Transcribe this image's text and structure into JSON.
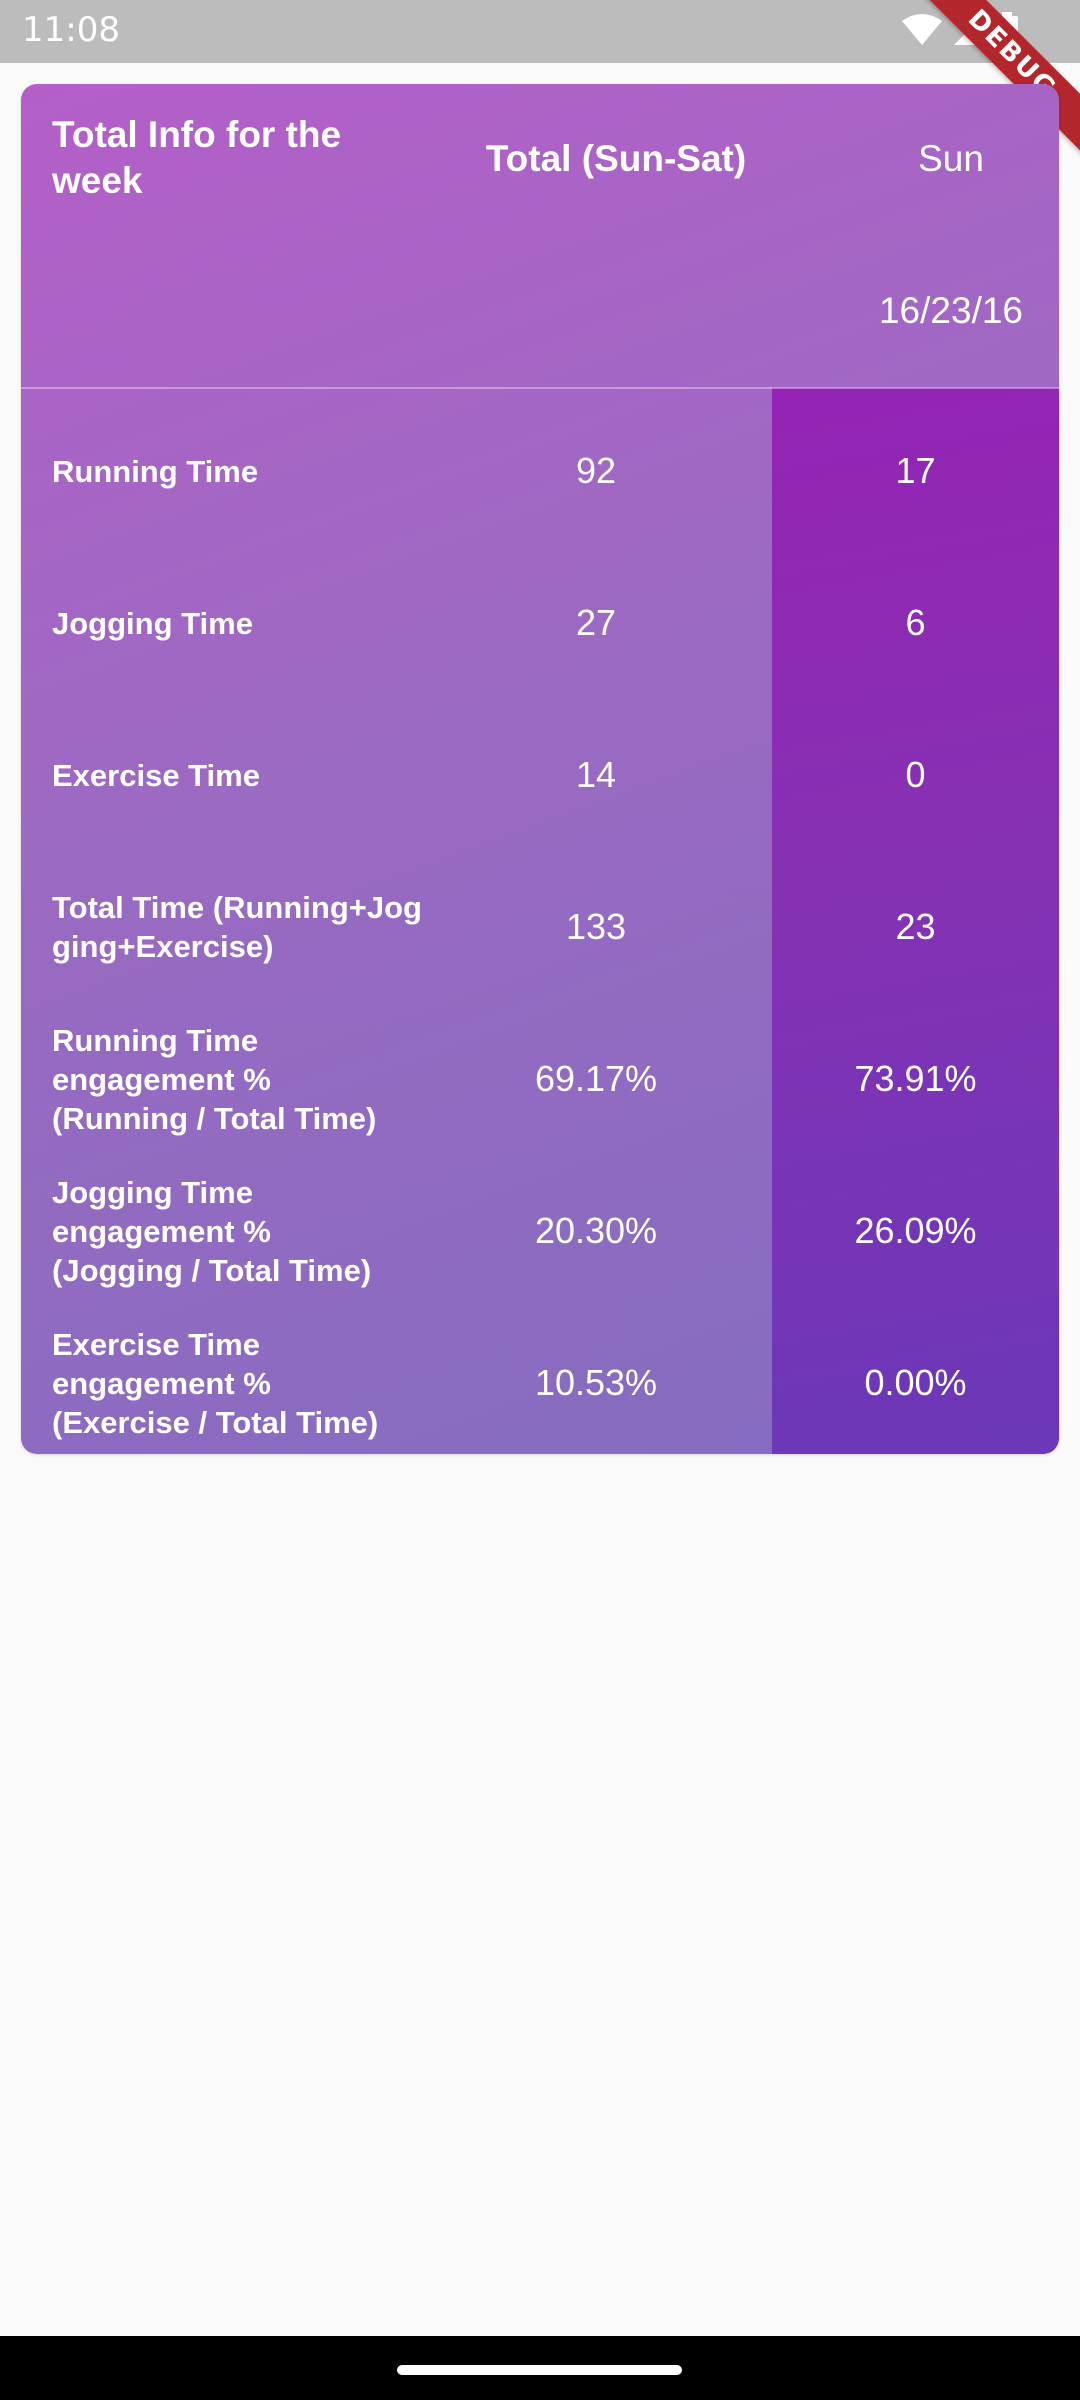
{
  "status_bar": {
    "time": "11:08",
    "icons": [
      "wifi-icon",
      "cellular-signal-icon",
      "battery-icon"
    ],
    "debug_label": "DEBUG"
  },
  "table": {
    "header": {
      "title": "Total Info for the week",
      "total_col": "Total (Sun-Sat)",
      "day_col": "Sun",
      "date": "16/23/16"
    },
    "rows": [
      {
        "label": "Running Time",
        "total": "92",
        "day": "17"
      },
      {
        "label": "Jogging Time",
        "total": "27",
        "day": "6"
      },
      {
        "label": "Exercise Time",
        "total": "14",
        "day": "0"
      },
      {
        "label": "Total Time (Running+Jog\nging+Exercise)",
        "total": "133",
        "day": "23"
      },
      {
        "label": "Running Time\nengagement %\n(Running / Total Time)",
        "total": "69.17%",
        "day": "73.91%"
      },
      {
        "label": "Jogging Time\nengagement %\n(Jogging / Total Time)",
        "total": "20.30%",
        "day": "26.09%"
      },
      {
        "label": "Exercise Time\nengagement %\n(Exercise / Total Time)",
        "total": "10.53%",
        "day": "0.00%"
      }
    ]
  },
  "colors": {
    "card_gradient_start": "#b45fc8",
    "card_gradient_end": "#836cc0",
    "highlight_start": "#9524b4",
    "highlight_end": "#6a38b8",
    "debug_ribbon": "#b3262b"
  }
}
